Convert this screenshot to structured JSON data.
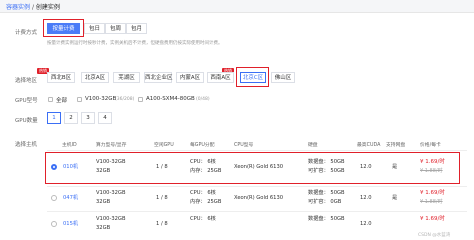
{
  "breadcrumb": {
    "root": "容器实例",
    "sep": "/",
    "current": "创建实例"
  },
  "billing": {
    "label": "计费方式",
    "options": [
      "按量计费",
      "包日",
      "包周",
      "包月"
    ],
    "selected": 0,
    "hint": "按量计费实例运行时按秒计费，实例关机后不计费，但硬盘费用仍按实际使用时间计费。"
  },
  "region": {
    "label": "选择地区",
    "options": [
      "西北B区",
      "北京A区",
      "芜湖区",
      "西北企业区",
      "内蒙A区",
      "西南A区",
      "北京C区",
      "佛山区"
    ],
    "selected": 6,
    "hot_badge": "热销",
    "hot_indices": [
      0,
      6
    ]
  },
  "gpu_model": {
    "label": "GPU型号",
    "options": [
      {
        "label": "全部",
        "count": ""
      },
      {
        "label": "V100-32GB",
        "count": "(36/208)"
      },
      {
        "label": "A100-SXM4-80GB",
        "count": "(0/48)"
      }
    ]
  },
  "gpu_count": {
    "label": "GPU数量",
    "options": [
      "1",
      "2",
      "3",
      "4"
    ],
    "selected": 0
  },
  "host": {
    "label": "选择主机",
    "headers": [
      "主机ID",
      "算力型号/显存",
      "空闲GPU",
      "每GPU分配",
      "CPU型号",
      "硬盘",
      "最高CUDA",
      "支持网盘",
      "价格/每卡"
    ],
    "rows": [
      {
        "id": "010机",
        "model": "V100-32GB",
        "mem": "32GB",
        "free": "1 / 8",
        "cpu": "CPU： 6核",
        "ram": "内存： 25GB",
        "cpu_model": "Xeon(R) Gold 6130",
        "disk1": "数据盘： 50GB",
        "disk2": "可扩容： 50GB",
        "cuda": "12.0",
        "netdisk": "是",
        "price": "¥ 1.69/时",
        "orig": "¥ 1.88/时",
        "selected": true
      },
      {
        "id": "047机",
        "model": "V100-32GB",
        "mem": "32GB",
        "free": "1 / 8",
        "cpu": "CPU： 6核",
        "ram": "内存： 25GB",
        "cpu_model": "Xeon(R) Gold 6130",
        "disk1": "数据盘： 50GB",
        "disk2": "可扩容： 0GB",
        "cuda": "12.0",
        "netdisk": "是",
        "price": "¥ 1.69/时",
        "orig": "¥ 1.88/时",
        "selected": false
      },
      {
        "id": "015机",
        "model": "V100-32GB",
        "mem": "32GB",
        "free": "1 / 8",
        "cpu": "CPU： 6核",
        "ram": "",
        "cpu_model": "",
        "disk1": "数据盘： 50GB",
        "disk2": "",
        "cuda": "12.0",
        "netdisk": "",
        "price": "¥ 1.69/时",
        "orig": "",
        "selected": false
      }
    ]
  },
  "watermark": "CSDN @水蓝湾",
  "colors": {
    "accent": "#3b6ff5",
    "highlight": "#e0202a"
  }
}
